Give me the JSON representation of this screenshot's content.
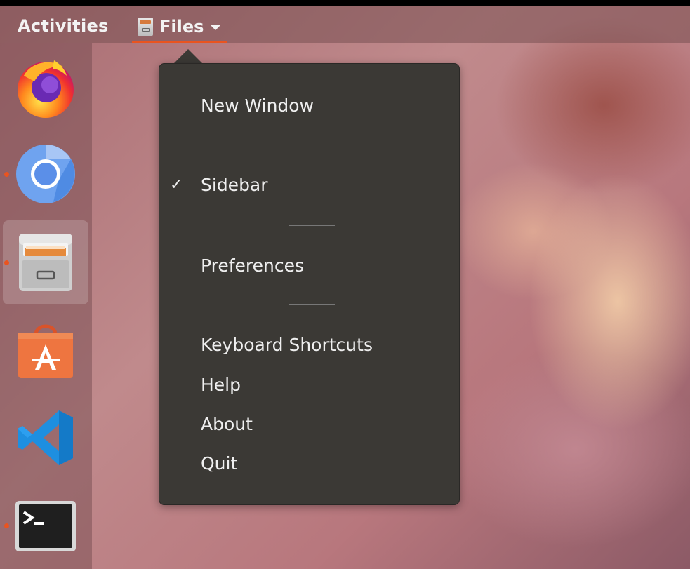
{
  "topbar": {
    "activities_label": "Activities",
    "app_menu_label": "Files",
    "accent_color": "#e95420"
  },
  "dock": {
    "items": [
      {
        "name": "Firefox",
        "icon": "firefox-icon",
        "running": false
      },
      {
        "name": "Chromium",
        "icon": "chromium-icon",
        "running": true
      },
      {
        "name": "Files",
        "icon": "files-cabinet-icon",
        "running": true,
        "active": true
      },
      {
        "name": "Ubuntu Software",
        "icon": "software-store-icon",
        "running": false
      },
      {
        "name": "Visual Studio Code",
        "icon": "vscode-icon",
        "running": false
      },
      {
        "name": "Terminal",
        "icon": "terminal-icon",
        "running": true
      }
    ]
  },
  "app_menu": {
    "items": {
      "new_window": "New Window",
      "sidebar": "Sidebar",
      "sidebar_checked": "✓",
      "preferences": "Preferences",
      "keyboard_shortcuts": "Keyboard Shortcuts",
      "help": "Help",
      "about": "About",
      "quit": "Quit"
    }
  }
}
